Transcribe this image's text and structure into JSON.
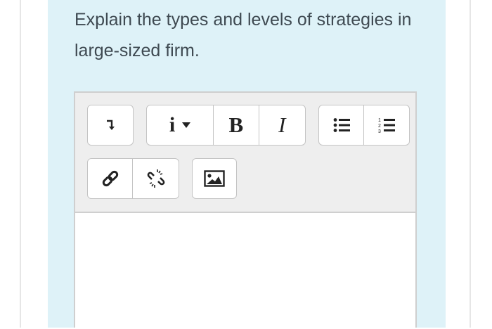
{
  "question": {
    "text": "Explain the types and levels of strategies in large-sized firm."
  },
  "editor": {
    "toolbar": {
      "row1": {
        "collapse": {
          "icon": "collapse-toolbar-icon"
        },
        "format_group": {
          "paragraph_label": "i",
          "paragraph_caret_icon": "caret-down-icon",
          "bold_label": "B",
          "italic_label": "I"
        },
        "list_group": {
          "unordered_icon": "unordered-list-icon",
          "ordered_icon": "ordered-list-icon"
        }
      },
      "row2": {
        "link_group": {
          "link_icon": "link-icon",
          "unlink_icon": "unlink-icon"
        },
        "image_icon": "image-icon"
      }
    },
    "content": {
      "value": ""
    }
  },
  "colors": {
    "panel_background": "#def2f8",
    "question_text": "#3f4a52",
    "toolbar_background": "#eeeeee",
    "button_border": "#c4c4c4"
  }
}
